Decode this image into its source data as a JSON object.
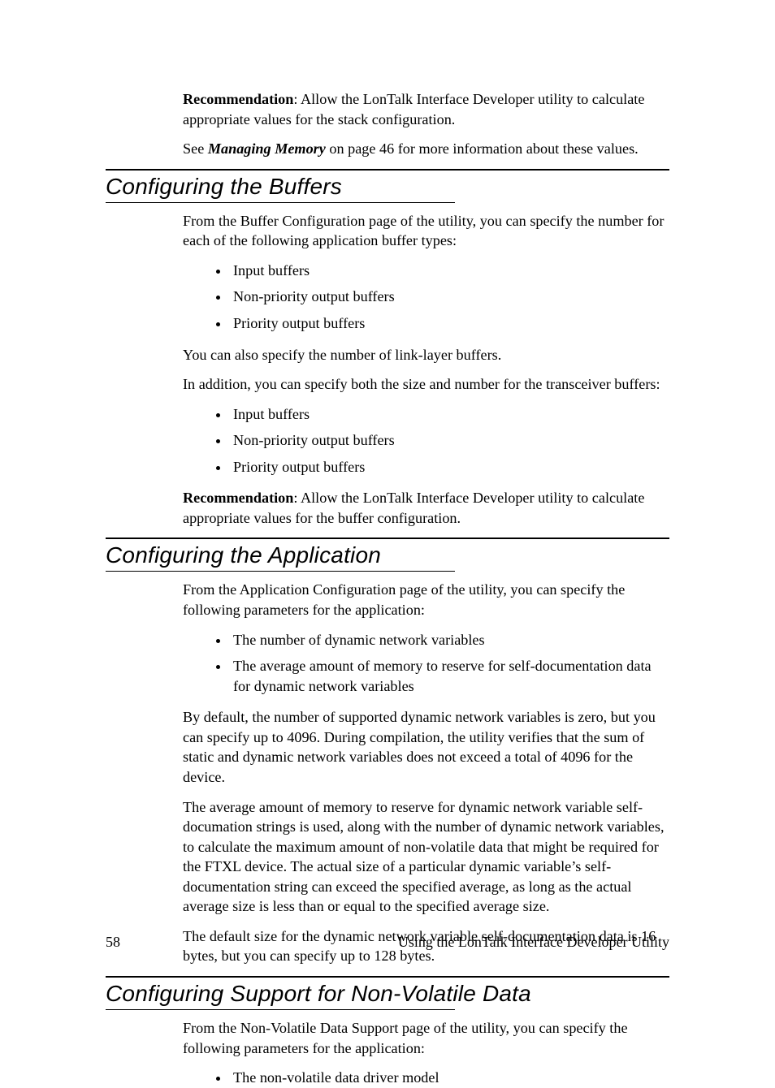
{
  "intro": {
    "rec_label": "Recommendation",
    "rec_text": ":  Allow the LonTalk Interface Developer utility to calculate appropriate values for the stack configuration.",
    "see_pre": "See ",
    "see_em": "Managing Memory",
    "see_post": " on page 46 for more information about these values."
  },
  "sec1": {
    "heading": "Configuring the Buffers",
    "p1": "From the Buffer Configuration page of the utility, you can specify the number for each of the following application buffer types:",
    "list1": [
      "Input buffers",
      "Non-priority output buffers",
      "Priority output buffers"
    ],
    "p2": "You can also specify the number of link-layer buffers.",
    "p3": "In addition, you can specify both the size and number for the transceiver buffers:",
    "list2": [
      "Input buffers",
      "Non-priority output buffers",
      "Priority output buffers"
    ],
    "rec_label": "Recommendation",
    "rec_text": ":  Allow the LonTalk Interface Developer utility to calculate appropriate values for the buffer configuration."
  },
  "sec2": {
    "heading": "Configuring the Application",
    "p1": "From the Application Configuration page of the utility, you can specify the following parameters for the application:",
    "list1": [
      "The number of dynamic network variables",
      "The average amount of memory to reserve for self-documentation data for dynamic network variables"
    ],
    "p2": "By default, the number of supported dynamic network variables is zero, but you can specify up to 4096.  During compilation, the utility verifies that the sum of static and dynamic network variables does not exceed a total of 4096 for the device.",
    "p3": "The average amount of memory to reserve for dynamic network variable self-documation strings is used, along with the number of dynamic network variables, to calculate the maximum amount of non-volatile data that might be required for the FTXL device.  The actual size of a particular dynamic variable’s self-documentation string can exceed the specified average, as long as the actual average size is less than or equal to the specified average size.",
    "p4": "The default size for the dynamic network variable self-documentation data is 16 bytes, but you can specify up to 128 bytes."
  },
  "sec3": {
    "heading": "Configuring Support for Non-Volatile Data",
    "p1": "From the Non-Volatile Data Support page of the utility, you can specify the following parameters for the application:",
    "list1": [
      "The non-volatile data driver model"
    ]
  },
  "footer": {
    "page_number": "58",
    "title": "Using the LonTalk Interface Developer Utility"
  }
}
